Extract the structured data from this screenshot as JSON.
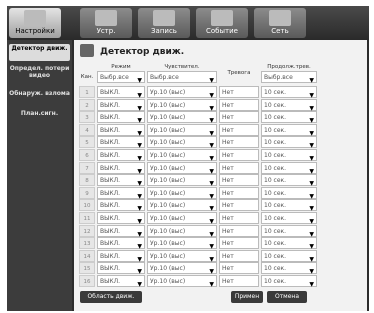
{
  "tabs": [
    {
      "label": "Настройки"
    },
    {
      "label": "Устр."
    },
    {
      "label": "Запись"
    },
    {
      "label": "Событие"
    },
    {
      "label": "Сеть"
    }
  ],
  "sidebar": {
    "items": [
      {
        "label": "Детектор движ."
      },
      {
        "label": "Определ. потери видео"
      },
      {
        "label": "Обнаруж. взлома"
      },
      {
        "label": "План.сигн."
      }
    ]
  },
  "page": {
    "title": "Детектор движ."
  },
  "table": {
    "headers": {
      "channel": "Кан.",
      "mode": "Режим",
      "sensitivity": "Чувствител.",
      "alarm": "Тревога",
      "duration": "Продолж.трев."
    },
    "select_all": {
      "mode": "Выбр.все",
      "sensitivity": "Выбр.все",
      "duration": "Выбр.все"
    },
    "rows": [
      {
        "ch": "1",
        "mode": "ВЫКЛ.",
        "sens": "Ур.10 (выс)",
        "alarm": "Нет",
        "dur": "10 сек."
      },
      {
        "ch": "2",
        "mode": "ВЫКЛ.",
        "sens": "Ур.10 (выс)",
        "alarm": "Нет",
        "dur": "10 сек."
      },
      {
        "ch": "3",
        "mode": "ВЫКЛ.",
        "sens": "Ур.10 (выс)",
        "alarm": "Нет",
        "dur": "10 сек."
      },
      {
        "ch": "4",
        "mode": "ВЫКЛ.",
        "sens": "Ур.10 (выс)",
        "alarm": "Нет",
        "dur": "10 сек."
      },
      {
        "ch": "5",
        "mode": "ВЫКЛ.",
        "sens": "Ур.10 (выс)",
        "alarm": "Нет",
        "dur": "10 сек."
      },
      {
        "ch": "6",
        "mode": "ВЫКЛ.",
        "sens": "Ур.10 (выс)",
        "alarm": "Нет",
        "dur": "10 сек."
      },
      {
        "ch": "7",
        "mode": "ВЫКЛ.",
        "sens": "Ур.10 (выс)",
        "alarm": "Нет",
        "dur": "10 сек."
      },
      {
        "ch": "8",
        "mode": "ВЫКЛ.",
        "sens": "Ур.10 (выс)",
        "alarm": "Нет",
        "dur": "10 сек."
      },
      {
        "ch": "9",
        "mode": "ВЫКЛ.",
        "sens": "Ур.10 (выс)",
        "alarm": "Нет",
        "dur": "10 сек."
      },
      {
        "ch": "10",
        "mode": "ВЫКЛ.",
        "sens": "Ур.10 (выс)",
        "alarm": "Нет",
        "dur": "10 сек."
      },
      {
        "ch": "11",
        "mode": "ВЫКЛ.",
        "sens": "Ур.10 (выс)",
        "alarm": "Нет",
        "dur": "10 сек."
      },
      {
        "ch": "12",
        "mode": "ВЫКЛ.",
        "sens": "Ур.10 (выс)",
        "alarm": "Нет",
        "dur": "10 сек."
      },
      {
        "ch": "13",
        "mode": "ВЫКЛ.",
        "sens": "Ур.10 (выс)",
        "alarm": "Нет",
        "dur": "10 сек."
      },
      {
        "ch": "14",
        "mode": "ВЫКЛ.",
        "sens": "Ур.10 (выс)",
        "alarm": "Нет",
        "dur": "10 сек."
      },
      {
        "ch": "15",
        "mode": "ВЫКЛ.",
        "sens": "Ур.10 (выс)",
        "alarm": "Нет",
        "dur": "10 сек."
      },
      {
        "ch": "16",
        "mode": "ВЫКЛ.",
        "sens": "Ур.10 (выс)",
        "alarm": "Нет",
        "dur": "10 сек."
      }
    ]
  },
  "buttons": {
    "motion_area": "Область движ.",
    "apply": "Примен",
    "cancel": "Отмена"
  },
  "icons": {
    "dropdown": "chevron-down-icon"
  }
}
